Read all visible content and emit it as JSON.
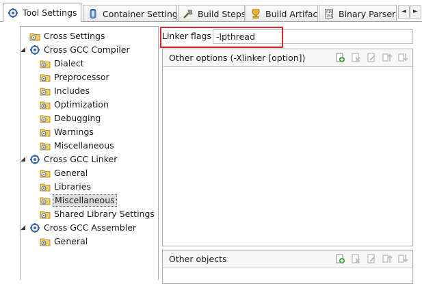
{
  "tabs": [
    {
      "label": "Tool Settings",
      "icon": "tool-settings-icon",
      "active": true
    },
    {
      "label": "Container Settings",
      "icon": "container-settings-icon",
      "active": false
    },
    {
      "label": "Build Steps",
      "icon": "build-steps-icon",
      "active": false
    },
    {
      "label": "Build Artifact",
      "icon": "build-artifact-icon",
      "active": false
    },
    {
      "label": "Binary Parsers",
      "icon": "binary-parsers-icon",
      "active": false
    }
  ],
  "tab_scroll": {
    "left": "◄",
    "right": "►"
  },
  "tree": [
    {
      "label": "Cross Settings",
      "level": 1,
      "icon": "folder-settings-icon"
    },
    {
      "label": "Cross GCC Compiler",
      "level": 0,
      "icon": "tool-gear-icon",
      "expanded": true
    },
    {
      "label": "Dialect",
      "level": 2,
      "icon": "folder-settings-icon"
    },
    {
      "label": "Preprocessor",
      "level": 2,
      "icon": "folder-settings-icon"
    },
    {
      "label": "Includes",
      "level": 2,
      "icon": "folder-settings-icon"
    },
    {
      "label": "Optimization",
      "level": 2,
      "icon": "folder-settings-icon"
    },
    {
      "label": "Debugging",
      "level": 2,
      "icon": "folder-settings-icon"
    },
    {
      "label": "Warnings",
      "level": 2,
      "icon": "folder-settings-icon"
    },
    {
      "label": "Miscellaneous",
      "level": 2,
      "icon": "folder-settings-icon"
    },
    {
      "label": "Cross GCC Linker",
      "level": 0,
      "icon": "tool-gear-icon",
      "expanded": true
    },
    {
      "label": "General",
      "level": 2,
      "icon": "folder-settings-icon"
    },
    {
      "label": "Libraries",
      "level": 2,
      "icon": "folder-settings-icon"
    },
    {
      "label": "Miscellaneous",
      "level": 2,
      "icon": "folder-settings-icon",
      "selected": true
    },
    {
      "label": "Shared Library Settings",
      "level": 2,
      "icon": "folder-settings-icon"
    },
    {
      "label": "Cross GCC Assembler",
      "level": 0,
      "icon": "tool-gear-icon",
      "expanded": true
    },
    {
      "label": "General",
      "level": 2,
      "icon": "folder-settings-icon"
    }
  ],
  "linker_flags": {
    "label": "Linker flags",
    "value": "-lpthread",
    "highlight_color": "#d9262b"
  },
  "other_options": {
    "title": "Other options (-Xlinker [option])"
  },
  "other_objects": {
    "title": "Other objects"
  },
  "list_tools": [
    "add-icon",
    "delete-icon",
    "edit-icon",
    "move-up-icon",
    "move-down-icon"
  ]
}
